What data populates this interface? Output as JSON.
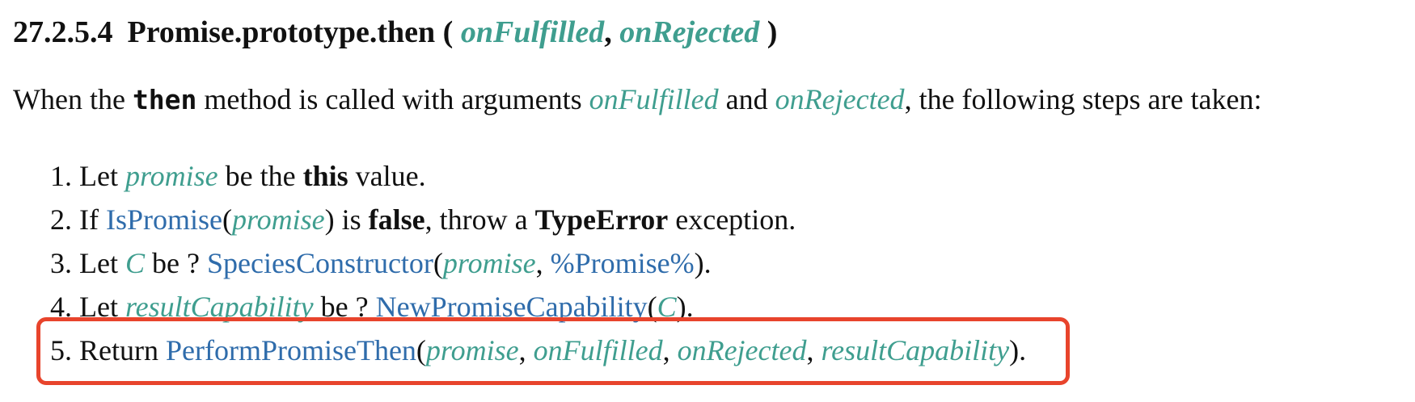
{
  "heading": {
    "section_number": "27.2.5.4",
    "name": "Promise.prototype.then",
    "open_paren": "(",
    "param1": "onFulfilled",
    "comma": ",",
    "param2": "onRejected",
    "close_paren": ")"
  },
  "intro": {
    "pre": "When the ",
    "code": "then",
    "mid1": " method is called with arguments ",
    "arg1": "onFulfilled",
    "mid2": " and ",
    "arg2": "onRejected",
    "post": ", the following steps are taken:"
  },
  "steps": {
    "s1": {
      "num": "1.",
      "t1": "Let ",
      "v1": "promise",
      "t2": " be the ",
      "b1": "this",
      "t3": " value."
    },
    "s2": {
      "num": "2.",
      "t1": "If ",
      "link1": "IsPromise",
      "p1": "(",
      "v1": "promise",
      "p2": ") is ",
      "b1": "false",
      "t2": ", throw a ",
      "b2": "TypeError",
      "t3": " exception."
    },
    "s3": {
      "num": "3.",
      "t1": "Let ",
      "v1": "C",
      "t2": " be ? ",
      "link1": "SpeciesConstructor",
      "p1": "(",
      "v2": "promise",
      "c1": ", ",
      "link2": "%Promise%",
      "p2": ")."
    },
    "s4": {
      "num": "4.",
      "t1": "Let ",
      "v1": "resultCapability",
      "t2": " be ? ",
      "link1": "NewPromiseCapability",
      "p1": "(",
      "v2": "C",
      "p2": ")."
    },
    "s5": {
      "num": "5.",
      "t1": "Return ",
      "link1": "PerformPromiseThen",
      "p1": "(",
      "v1": "promise",
      "c1": ", ",
      "v2": "onFulfilled",
      "c2": ", ",
      "v3": "onRejected",
      "c3": ", ",
      "v4": "resultCapability",
      "p2": ")."
    }
  },
  "colors": {
    "variable": "#3f9e8f",
    "link": "#2f6cab",
    "highlight_border": "#e8442c"
  }
}
